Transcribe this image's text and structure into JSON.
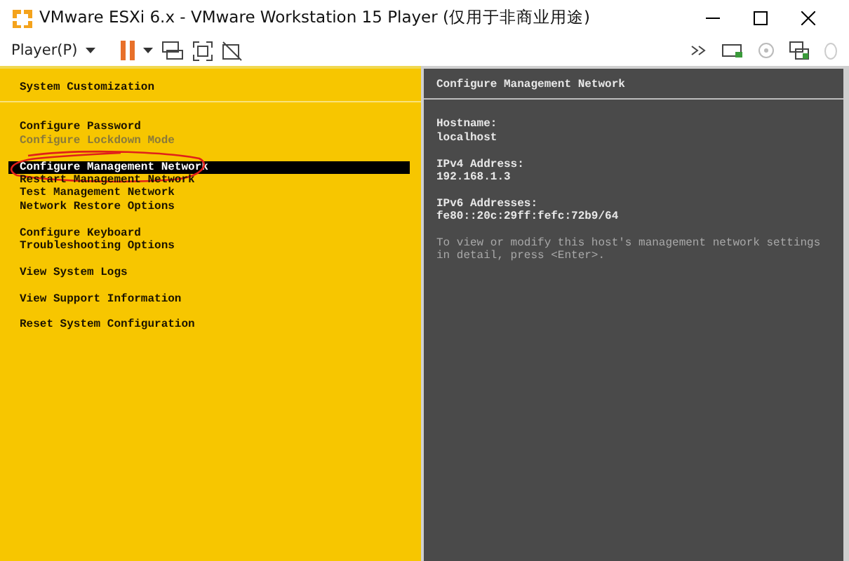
{
  "window": {
    "title": "VMware ESXi 6.x - VMware Workstation 15 Player (仅用于非商业用途)"
  },
  "toolbar": {
    "player_menu": "Player(P)"
  },
  "left_panel": {
    "title": "System Customization",
    "groups": [
      {
        "items": [
          {
            "label": "Configure Password",
            "selected": false,
            "disabled": false,
            "circled": false
          },
          {
            "label": "Configure Lockdown Mode",
            "selected": false,
            "disabled": true,
            "circled": false
          }
        ]
      },
      {
        "items": [
          {
            "label": "Configure Management Network",
            "selected": true,
            "disabled": false,
            "circled": true
          },
          {
            "label": "Restart Management Network",
            "selected": false,
            "disabled": false,
            "circled": false
          },
          {
            "label": "Test Management Network",
            "selected": false,
            "disabled": false,
            "circled": false
          },
          {
            "label": "Network Restore Options",
            "selected": false,
            "disabled": false,
            "circled": false
          }
        ]
      },
      {
        "items": [
          {
            "label": "Configure Keyboard",
            "selected": false,
            "disabled": false,
            "circled": false
          },
          {
            "label": "Troubleshooting Options",
            "selected": false,
            "disabled": false,
            "circled": false
          }
        ]
      },
      {
        "items": [
          {
            "label": "View System Logs",
            "selected": false,
            "disabled": false,
            "circled": false
          }
        ]
      },
      {
        "items": [
          {
            "label": "View Support Information",
            "selected": false,
            "disabled": false,
            "circled": false
          }
        ]
      },
      {
        "items": [
          {
            "label": "Reset System Configuration",
            "selected": false,
            "disabled": false,
            "circled": false
          }
        ]
      }
    ]
  },
  "right_panel": {
    "title": "Configure Management Network",
    "fields": [
      {
        "label": "Hostname:",
        "value": "localhost"
      },
      {
        "label": "IPv4 Address:",
        "value": "192.168.1.3"
      },
      {
        "label": "IPv6 Addresses:",
        "value": "fe80::20c:29ff:fefc:72b9/64"
      }
    ],
    "note": "To view or modify this host's management network settings in detail, press <Enter>."
  }
}
